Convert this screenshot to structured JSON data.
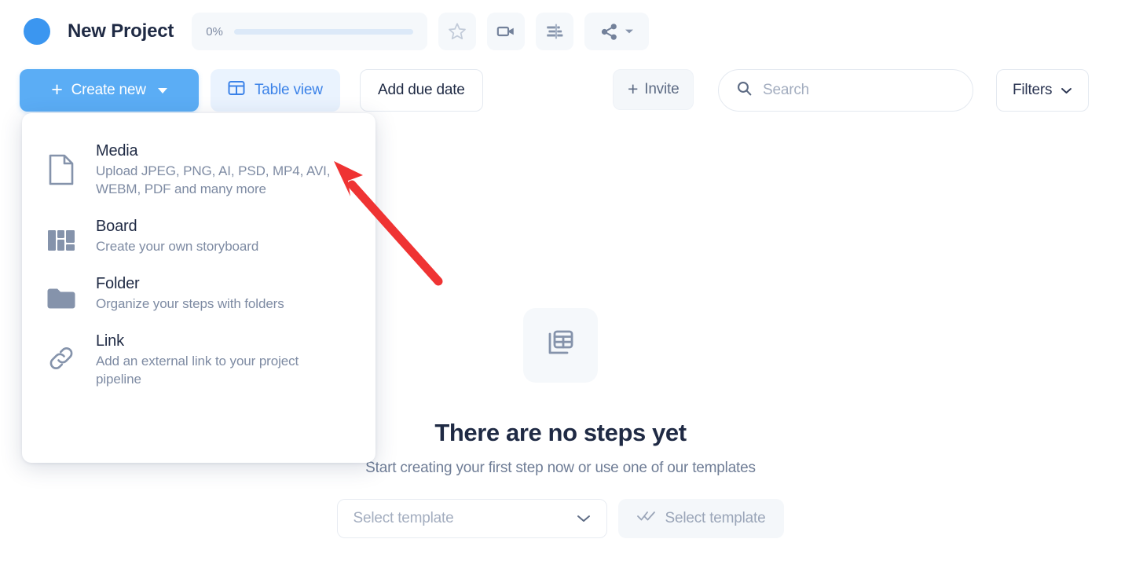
{
  "header": {
    "project_dot_color": "#3b96f0",
    "project_title": "New Project",
    "progress_percent": "0%",
    "progress_value": 0,
    "icons": {
      "favorite": "star-icon",
      "record": "video-camera-icon",
      "distribute": "align-distribute-icon",
      "share": "share-icon"
    }
  },
  "toolbar": {
    "create_new_label": "Create new",
    "table_view_label": "Table view",
    "add_due_date_label": "Add due date",
    "invite_label": "Invite",
    "search_placeholder": "Search",
    "search_value": "",
    "filters_label": "Filters",
    "accent_color": "#5badf5",
    "tab_active_color": "#3b82e8"
  },
  "create_menu": {
    "items": [
      {
        "icon": "document-icon",
        "title": "Media",
        "desc": "Upload JPEG, PNG, AI, PSD, MP4, AVI, WEBM, PDF and many more"
      },
      {
        "icon": "board-layout-icon",
        "title": "Board",
        "desc": "Create your own storyboard"
      },
      {
        "icon": "folder-icon",
        "title": "Folder",
        "desc": "Organize your steps with folders"
      },
      {
        "icon": "link-icon",
        "title": "Link",
        "desc": "Add an external link to your project pipeline"
      }
    ]
  },
  "empty_state": {
    "icon": "table-grid-icon",
    "title": "There are no steps yet",
    "subtitle": "Start creating your first step now or use one of our templates",
    "template_select_placeholder": "Select template",
    "template_button_label": "Select template"
  },
  "annotation": {
    "arrow_color": "#ef3333"
  }
}
